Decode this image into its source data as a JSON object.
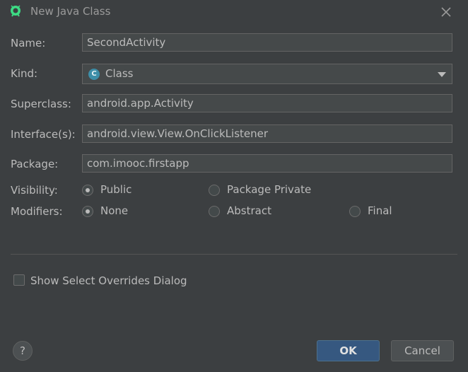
{
  "window": {
    "title": "New Java Class"
  },
  "form": {
    "name": {
      "label": "Name:",
      "value": "SecondActivity"
    },
    "kind": {
      "label": "Kind:",
      "value": "Class",
      "icon_letter": "C"
    },
    "superclass": {
      "label": "Superclass:",
      "value": "android.app.Activity"
    },
    "interfaces": {
      "label": "Interface(s):",
      "value": "android.view.View.OnClickListener"
    },
    "package": {
      "label": "Package:",
      "value": "com.imooc.firstapp"
    },
    "visibility": {
      "label": "Visibility:",
      "options": [
        {
          "label": "Public",
          "selected": true
        },
        {
          "label": "Package Private",
          "selected": false
        }
      ]
    },
    "modifiers": {
      "label": "Modifiers:",
      "options": [
        {
          "label": "None",
          "selected": true
        },
        {
          "label": "Abstract",
          "selected": false
        },
        {
          "label": "Final",
          "selected": false
        }
      ]
    },
    "show_overrides": {
      "label": "Show Select Overrides Dialog",
      "checked": false
    }
  },
  "buttons": {
    "help": "?",
    "ok": "OK",
    "cancel": "Cancel"
  },
  "colors": {
    "background": "#3c3f41",
    "field": "#45494a",
    "ok_button": "#365880",
    "class_icon": "#3d8ea8"
  }
}
